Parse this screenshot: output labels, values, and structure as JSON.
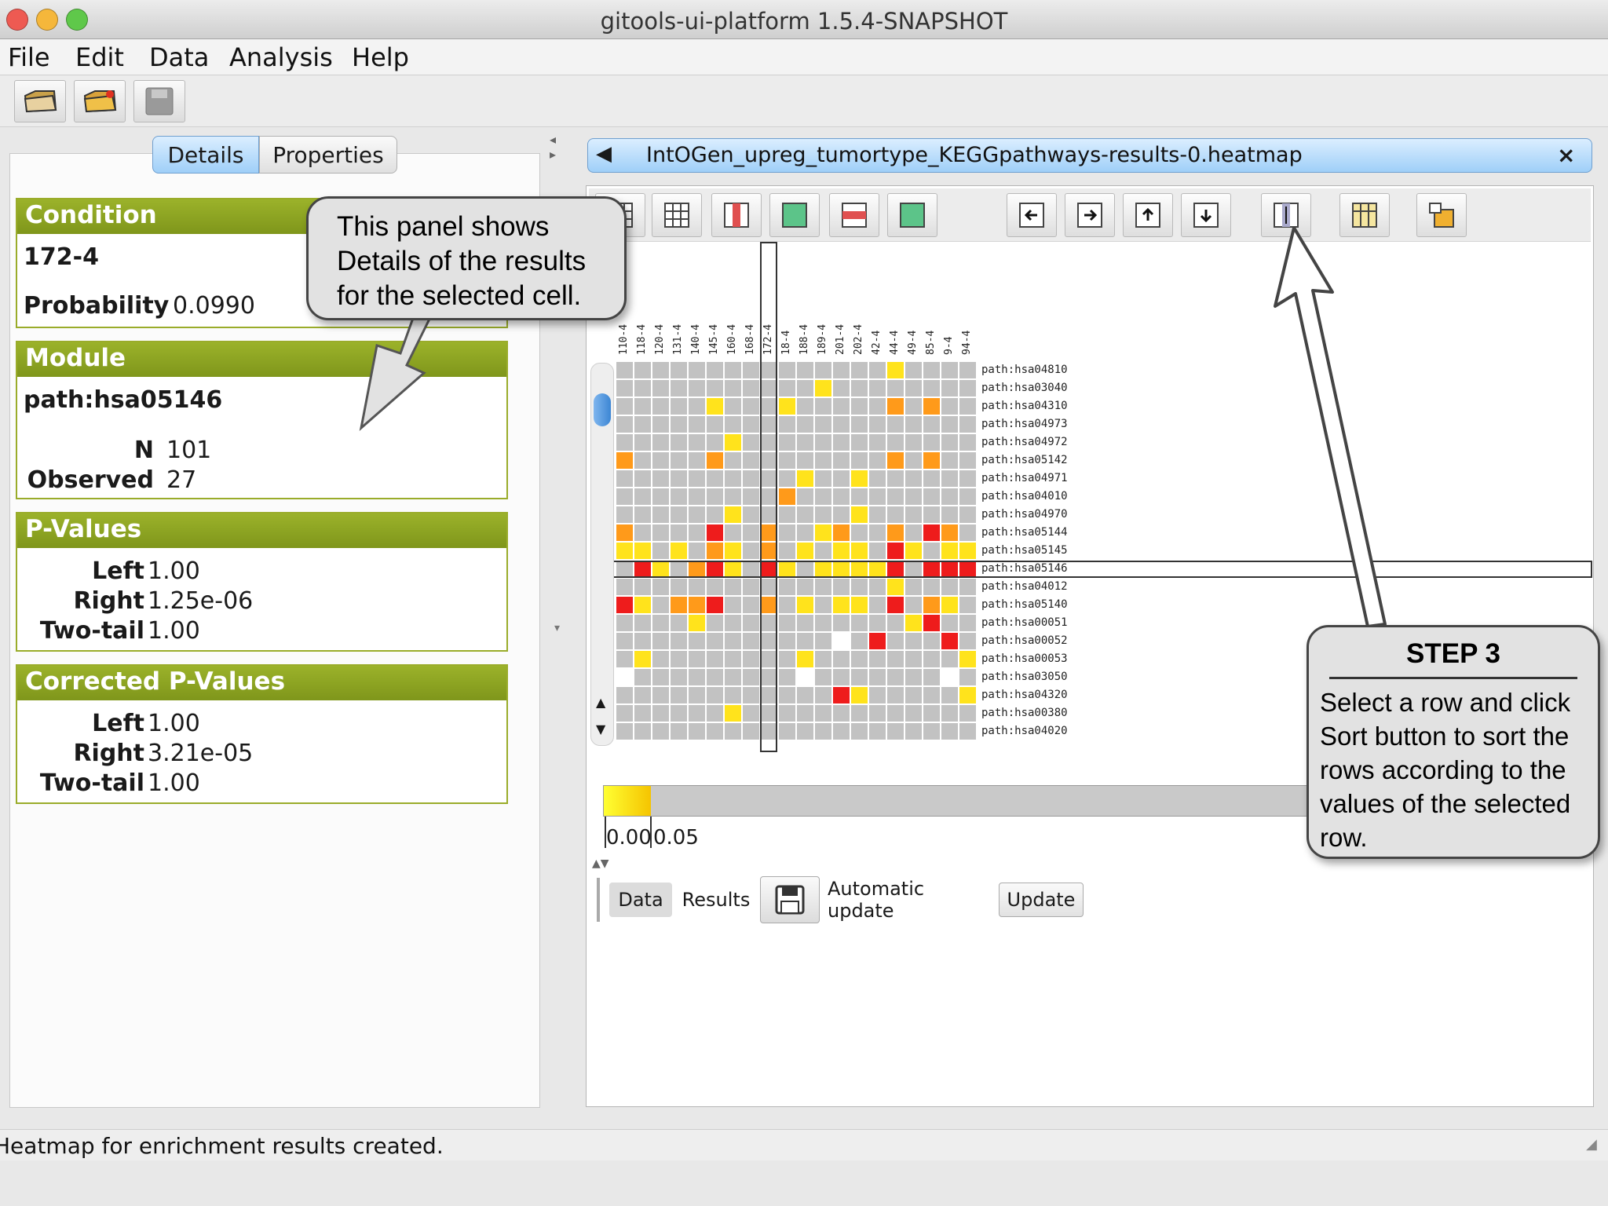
{
  "window": {
    "title": "gitools-ui-platform 1.5.4-SNAPSHOT"
  },
  "menu": [
    "File",
    "Edit",
    "Data",
    "Analysis",
    "Help"
  ],
  "toolbar": {
    "icons": [
      "open-folder-icon",
      "open-project-icon",
      "save-icon"
    ]
  },
  "left_tabs": {
    "details": "Details",
    "properties": "Properties"
  },
  "details": {
    "condition": {
      "header": "Condition",
      "value": "172-4",
      "prob_label": "Probability",
      "prob_value": "0.0990"
    },
    "module": {
      "header": "Module",
      "value": "path:hsa05146",
      "n_label": "N",
      "n_value": "101",
      "obs_label": "Observed",
      "obs_value": "27"
    },
    "pvalues": {
      "header": "P-Values",
      "left_label": "Left",
      "left_value": "1.00",
      "right_label": "Right",
      "right_value": "1.25e-06",
      "two_label": "Two-tail",
      "two_value": "1.00"
    },
    "corrected": {
      "header": "Corrected P-Values",
      "left_label": "Left",
      "left_value": "1.00",
      "right_label": "Right",
      "right_value": "3.21e-05",
      "two_label": "Two-tail",
      "two_value": "1.00"
    }
  },
  "document_tab": {
    "title": "IntOGen_upreg_tumortype_KEGGpathways-results-0.heatmap"
  },
  "heatmap": {
    "columns": [
      "110-4",
      "118-4",
      "120-4",
      "131-4",
      "140-4",
      "145-4",
      "160-4",
      "168-4",
      "172-4",
      "18-4",
      "188-4",
      "189-4",
      "201-4",
      "202-4",
      "42-4",
      "44-4",
      "49-4",
      "85-4",
      "9-4",
      "94-4"
    ],
    "rows": [
      "path:hsa04810",
      "path:hsa03040",
      "path:hsa04310",
      "path:hsa04973",
      "path:hsa04972",
      "path:hsa05142",
      "path:hsa04971",
      "path:hsa04010",
      "path:hsa04970",
      "path:hsa05144",
      "path:hsa05145",
      "path:hsa05146",
      "path:hsa04012",
      "path:hsa05140",
      "path:hsa00051",
      "path:hsa00052",
      "path:hsa00053",
      "path:hsa03050",
      "path:hsa04320",
      "path:hsa00380",
      "path:hsa04020"
    ],
    "selected_row": "path:hsa05146",
    "selected_column": "172-4"
  },
  "legend": {
    "min_label": "0.00",
    "max_label": "0.05",
    "colors": [
      "#ffff33",
      "#f5c400"
    ]
  },
  "bottom_tabs": {
    "data": "Data",
    "results": "Results",
    "auto_update": "Automatic update",
    "update": "Update"
  },
  "callouts": {
    "panel": {
      "line1": "This panel shows",
      "line2": "Details of the results",
      "line3": "for the selected cell."
    },
    "step": {
      "title": "STEP 3",
      "line1": "Select a row and click",
      "line2": "Sort button to sort the",
      "line3": "rows according to the",
      "line4": "values of the selected",
      "line5": "row."
    }
  },
  "status": "Heatmap for enrichment results created.",
  "colors": {
    "header_green": "#8da224",
    "selected_tab_blue": "#9fcff8",
    "cell_gray": "#c2c2c2",
    "yellow": "#ffe31c",
    "orange": "#ff9a1a",
    "red": "#ee1c1c"
  }
}
